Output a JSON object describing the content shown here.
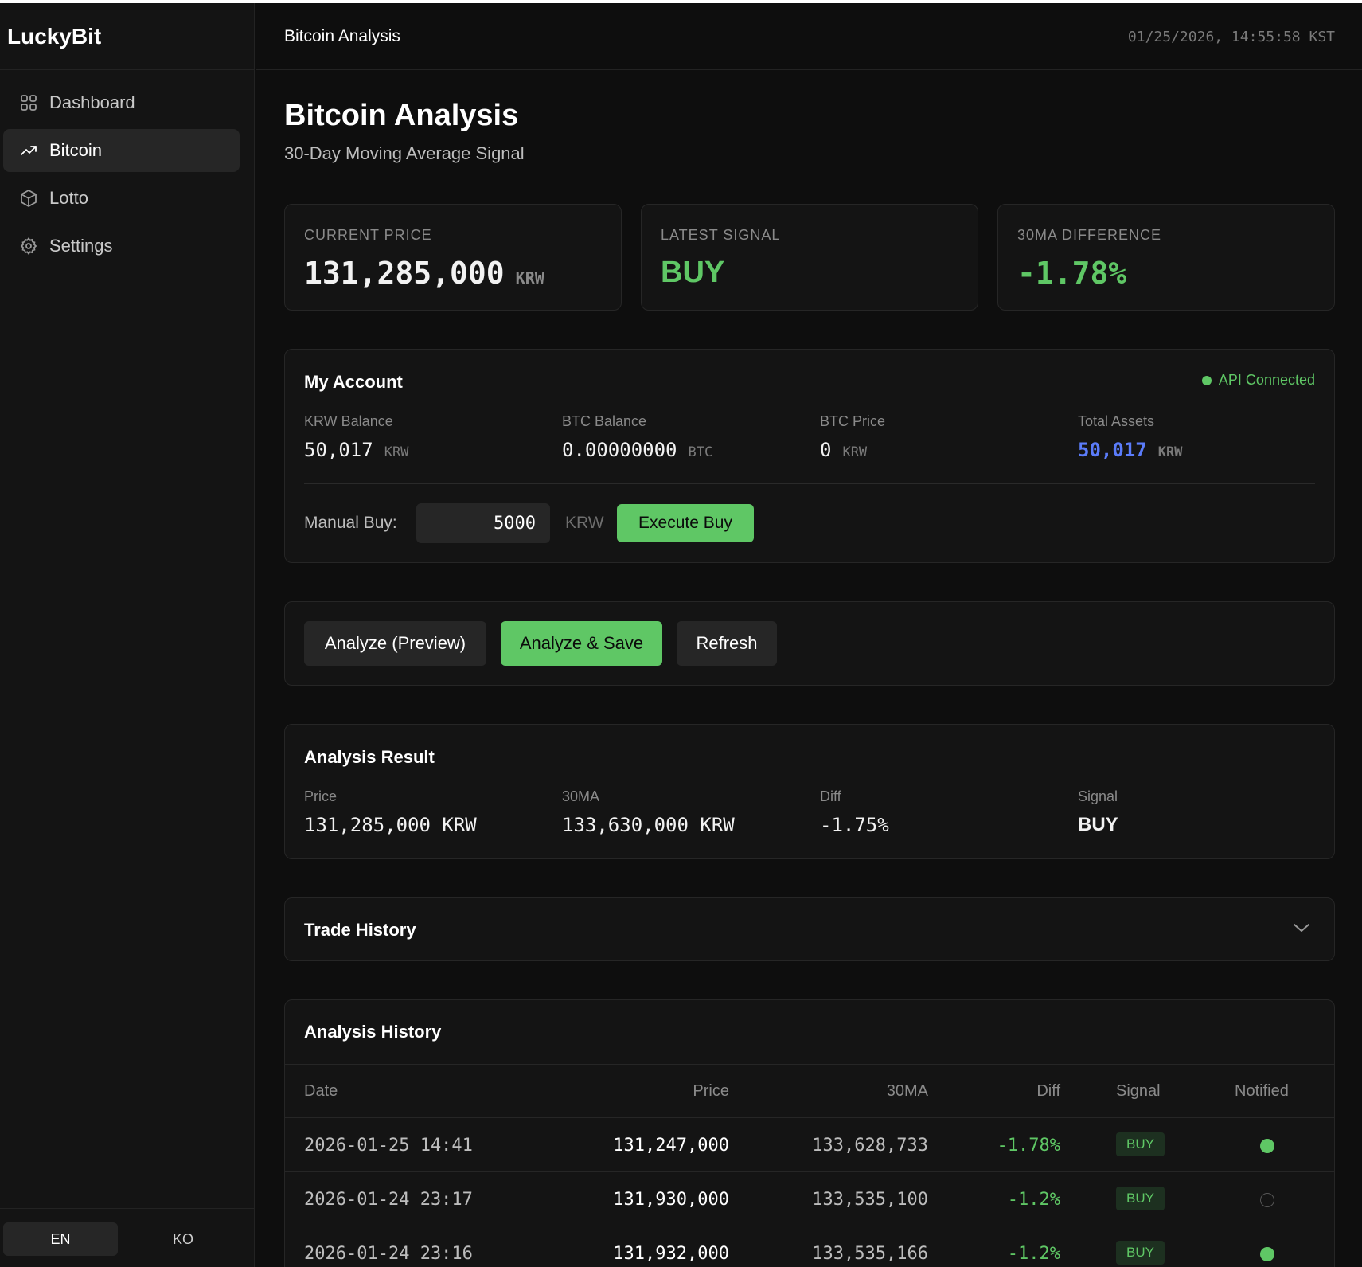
{
  "app": {
    "brand": "LuckyBit"
  },
  "sidebar": {
    "items": [
      {
        "label": "Dashboard",
        "icon": "grid-icon",
        "active": false
      },
      {
        "label": "Bitcoin",
        "icon": "trending-up-icon",
        "active": true
      },
      {
        "label": "Lotto",
        "icon": "box-icon",
        "active": false
      },
      {
        "label": "Settings",
        "icon": "gear-icon",
        "active": false
      }
    ],
    "lang": {
      "en": "EN",
      "ko": "KO",
      "selected": "EN"
    }
  },
  "header": {
    "title": "Bitcoin Analysis",
    "time": "01/25/2026, 14:55:58 KST"
  },
  "page": {
    "title": "Bitcoin Analysis",
    "subtitle": "30-Day Moving Average Signal"
  },
  "stats": {
    "current_price": {
      "label": "CURRENT PRICE",
      "value": "131,285,000",
      "unit": "KRW"
    },
    "latest_signal": {
      "label": "LATEST SIGNAL",
      "value": "BUY"
    },
    "ma_diff": {
      "label": "30MA DIFFERENCE",
      "value": "-1.78%"
    }
  },
  "account": {
    "title": "My Account",
    "status": "API Connected",
    "krw_balance": {
      "label": "KRW Balance",
      "value": "50,017",
      "unit": "KRW"
    },
    "btc_balance": {
      "label": "BTC Balance",
      "value": "0.00000000",
      "unit": "BTC"
    },
    "btc_price": {
      "label": "BTC Price",
      "value": "0",
      "unit": "KRW"
    },
    "total_assets": {
      "label": "Total Assets",
      "value": "50,017",
      "unit": "KRW"
    },
    "manual_buy": {
      "label": "Manual Buy:",
      "value": "5000",
      "unit": "KRW",
      "button": "Execute Buy"
    }
  },
  "actions": {
    "preview": "Analyze (Preview)",
    "save": "Analyze & Save",
    "refresh": "Refresh"
  },
  "result": {
    "title": "Analysis Result",
    "price": {
      "label": "Price",
      "value": "131,285,000 KRW"
    },
    "ma": {
      "label": "30MA",
      "value": "133,630,000 KRW"
    },
    "diff": {
      "label": "Diff",
      "value": "-1.75%"
    },
    "signal": {
      "label": "Signal",
      "value": "BUY"
    }
  },
  "trade_history": {
    "title": "Trade History"
  },
  "history": {
    "title": "Analysis History",
    "columns": [
      "Date",
      "Price",
      "30MA",
      "Diff",
      "Signal",
      "Notified"
    ],
    "rows": [
      {
        "date": "2026-01-25 14:41",
        "price": "131,247,000",
        "ma": "133,628,733",
        "diff": "-1.78%",
        "signal": "BUY",
        "notified": true
      },
      {
        "date": "2026-01-24 23:17",
        "price": "131,930,000",
        "ma": "133,535,100",
        "diff": "-1.2%",
        "signal": "BUY",
        "notified": false
      },
      {
        "date": "2026-01-24 23:16",
        "price": "131,932,000",
        "ma": "133,535,166",
        "diff": "-1.2%",
        "signal": "BUY",
        "notified": true
      }
    ]
  },
  "colors": {
    "accent": "#5fc765",
    "assets": "#5b7cfa",
    "background": "#0e0e0e",
    "card": "#141414"
  }
}
